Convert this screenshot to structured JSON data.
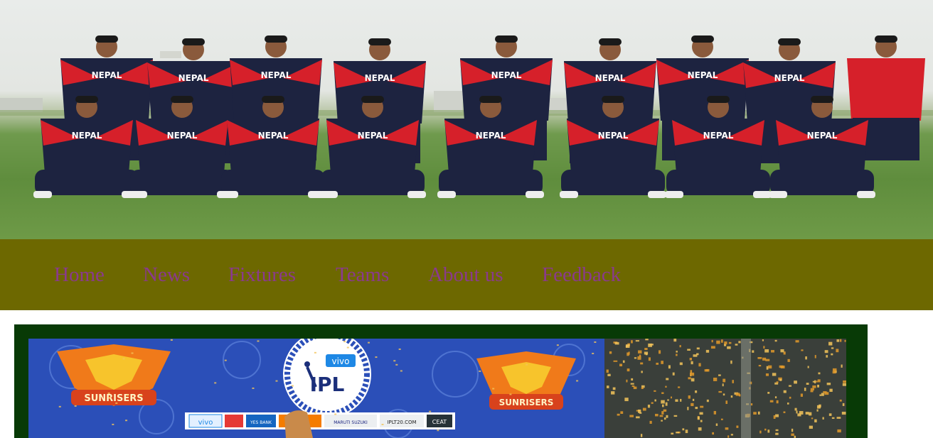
{
  "banner": {
    "jersey_text": "NEPAL",
    "colors": {
      "navy": "#1d2340",
      "red": "#d6202a",
      "grass": "#5f8d3d"
    }
  },
  "nav": {
    "items": [
      {
        "label": "Home"
      },
      {
        "label": "News"
      },
      {
        "label": "Fixtures"
      },
      {
        "label": "Teams"
      },
      {
        "label": "About us"
      },
      {
        "label": "Feedback"
      }
    ],
    "colors": {
      "bar": "#6d6800",
      "link": "#8a3a8c"
    }
  },
  "feature": {
    "frame_color": "#083a06",
    "logo_left": "SUNRISERS",
    "logo_right": "SUNRISERS",
    "ipl_logo_top": "vivo",
    "ipl_logo_main": "IPL",
    "sponsor_strip": [
      "vivo",
      "YES BANK",
      "MARUTI SUZUKI",
      "IPLT20.COM",
      "CEAT"
    ]
  }
}
